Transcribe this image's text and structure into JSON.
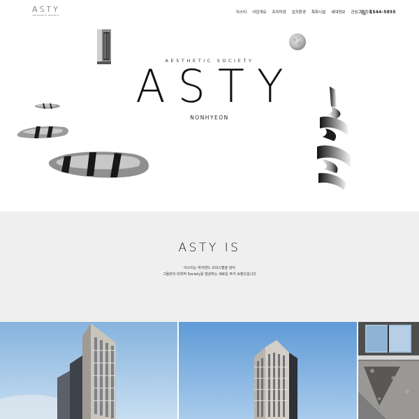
{
  "header": {
    "logo": "ASTY",
    "logo_sub": "AESTHETIC SOCIETY",
    "nav": [
      "아스티",
      "사업개요",
      "프리미엄",
      "입지환경",
      "특화시설",
      "세대정보",
      "관심고객등록"
    ],
    "phone_icon": "phone-icon",
    "phone": "1544-5855"
  },
  "hero": {
    "overline": "AESTHETIC SOCIETY",
    "title": "ASTY",
    "subtitle": "NONHYEON",
    "decorations": [
      "sculpture-stones",
      "moon",
      "spiral-ribbon",
      "building-model"
    ]
  },
  "intro": {
    "title": "ASTY IS",
    "lines": [
      "아스티는 하이엔드 오피스텔을 넘어",
      "그들만의 미학적 Society를 형성하는 새로운 주거 브랜드입니다"
    ],
    "background": "#efefef"
  },
  "gallery": {
    "tiles": [
      "building-exterior-left",
      "building-exterior-center",
      "building-detail-right"
    ]
  },
  "colors": {
    "accent": "#111111",
    "sky": "#9fc4e6",
    "intro_bg": "#efefef"
  }
}
